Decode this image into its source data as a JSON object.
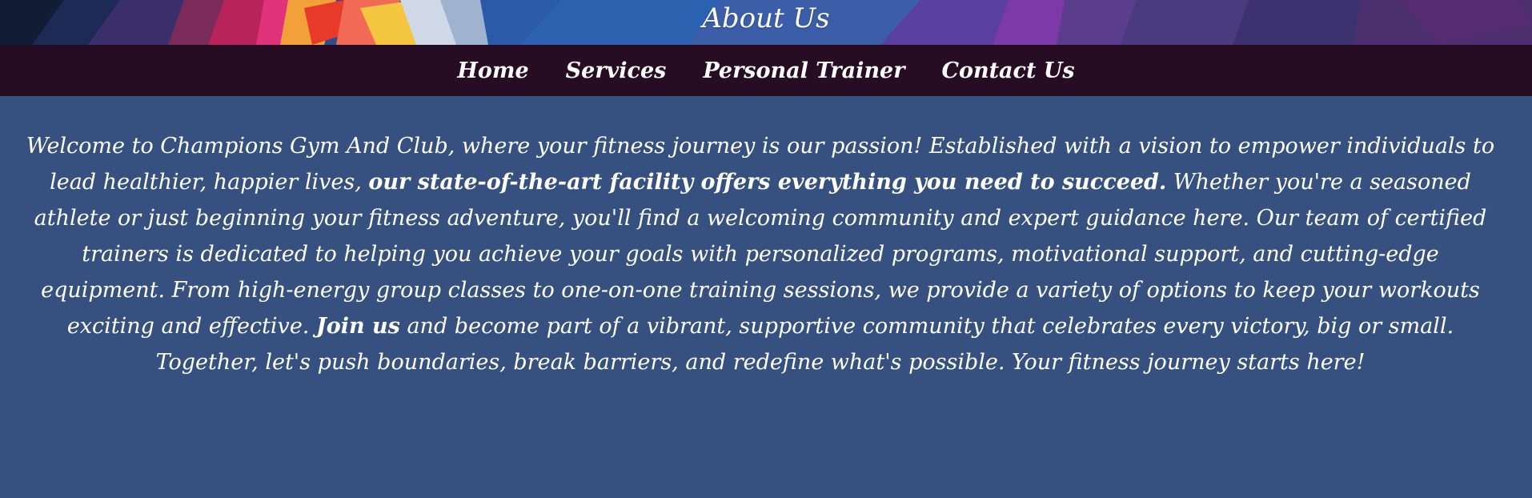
{
  "banner": {
    "title": "About Us"
  },
  "nav": {
    "items": [
      {
        "label": "Home"
      },
      {
        "label": "Services"
      },
      {
        "label": "Personal Trainer"
      },
      {
        "label": "Contact Us"
      }
    ]
  },
  "about": {
    "text_intro": "Welcome to Champions Gym And Club, where your fitness journey is our passion! Established with a vision to empower individuals to lead healthier, happier lives, ",
    "text_bold_1": "our state-of-the-art facility offers everything you need to succeed.",
    "text_middle": " Whether you're a seasoned athlete or just beginning your fitness adventure, you'll find a welcoming community and expert guidance here. Our team of certified trainers is dedicated to helping you achieve your goals with personalized programs, motivational support, and cutting-edge equipment. From high-energy group classes to one-on-one training sessions, we provide a variety of options to keep your workouts exciting and effective. ",
    "text_bold_2": "Join us",
    "text_end": " and become part of a vibrant, supportive community that celebrates every victory, big or small. Together, let's push boundaries, break barriers, and redefine what's possible. Your fitness journey starts here!"
  },
  "colors": {
    "page_background": "#36517f",
    "nav_background": "#270d24",
    "text": "#ffffff"
  }
}
